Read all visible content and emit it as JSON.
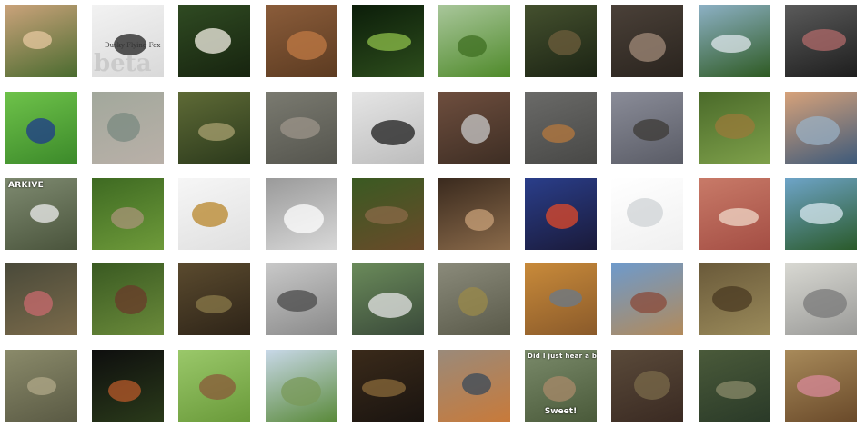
{
  "grid": {
    "rows": 5,
    "cols": 10,
    "tiles": [
      {
        "subject": "leopard-gecko",
        "bg": [
          "#c9a27a",
          "#4a6b2f"
        ],
        "accent": "#e7c8a0"
      },
      {
        "subject": "book-cover",
        "bg": [
          "#f2f2f2",
          "#d9d9d9"
        ],
        "accent": "#222222",
        "title": "Dusky Flying Fox",
        "big": "beta"
      },
      {
        "subject": "white-flower",
        "bg": [
          "#2f4a22",
          "#17240f"
        ],
        "accent": "#f4f0e6"
      },
      {
        "subject": "salamander-on-leaves",
        "bg": [
          "#8a5c3a",
          "#5c3b21"
        ],
        "accent": "#c07a44"
      },
      {
        "subject": "tree-frog",
        "bg": [
          "#0c1e0a",
          "#2d4d1c"
        ],
        "accent": "#8dbf4a"
      },
      {
        "subject": "meadow",
        "bg": [
          "#a8c69a",
          "#4f8a2a"
        ],
        "accent": "#3f6f22"
      },
      {
        "subject": "owl-in-tree",
        "bg": [
          "#44502e",
          "#1c2414"
        ],
        "accent": "#6e5e3c"
      },
      {
        "subject": "split-shell",
        "bg": [
          "#4a4038",
          "#2a241e"
        ],
        "accent": "#a08a78"
      },
      {
        "subject": "greenhouse-dome",
        "bg": [
          "#8cb0c4",
          "#2e5a22"
        ],
        "accent": "#dfe7ec"
      },
      {
        "subject": "dark-panel",
        "bg": [
          "#5a5a5a",
          "#1e1e1e"
        ],
        "accent": "#b06a6a"
      },
      {
        "subject": "blue-dart-frog",
        "bg": [
          "#6ec24a",
          "#3c8a2a"
        ],
        "accent": "#1e3a8c"
      },
      {
        "subject": "fabric-texture",
        "bg": [
          "#a2a89c",
          "#b9b0a8"
        ],
        "accent": "#7a8a80"
      },
      {
        "subject": "forest-stream",
        "bg": [
          "#5e6a36",
          "#2c3a1c"
        ],
        "accent": "#a8a070"
      },
      {
        "subject": "rock-surface",
        "bg": [
          "#7a7a70",
          "#55554e"
        ],
        "accent": "#9c948a"
      },
      {
        "subject": "bee-on-white",
        "bg": [
          "#e5e5e5",
          "#bdbdbd"
        ],
        "accent": "#1e1e1e"
      },
      {
        "subject": "gloved-hands-gravel",
        "bg": [
          "#6e4e3e",
          "#3e2e24"
        ],
        "accent": "#c8c8c8"
      },
      {
        "subject": "toad-on-rock",
        "bg": [
          "#6a6a68",
          "#484846"
        ],
        "accent": "#b5783e"
      },
      {
        "subject": "frog-in-burrow",
        "bg": [
          "#8a8c98",
          "#5a5c66"
        ],
        "accent": "#3c3a36"
      },
      {
        "subject": "newt-in-grass",
        "bg": [
          "#4a6a2a",
          "#7ea04a"
        ],
        "accent": "#9a7a3a"
      },
      {
        "subject": "lake-sunset",
        "bg": [
          "#d7a27a",
          "#3e5a7a"
        ],
        "accent": "#9ab0c4"
      },
      {
        "subject": "branches",
        "bg": [
          "#7e8a70",
          "#4a543c"
        ],
        "accent": "#eeeeee",
        "caption": "ARKIVE"
      },
      {
        "subject": "seed-pod",
        "bg": [
          "#3e6a22",
          "#6e9a3a"
        ],
        "accent": "#a89478"
      },
      {
        "subject": "golden-figurine",
        "bg": [
          "#f6f6f6",
          "#e0e0e0"
        ],
        "accent": "#b8862a"
      },
      {
        "subject": "sem-structure",
        "bg": [
          "#9a9a9a",
          "#d8d8d8"
        ],
        "accent": "#ffffff"
      },
      {
        "subject": "hedgehog-pair",
        "bg": [
          "#3a5a22",
          "#6a4a2a"
        ],
        "accent": "#8a6a48"
      },
      {
        "subject": "deer",
        "bg": [
          "#3a2a1e",
          "#8a6a4a"
        ],
        "accent": "#c8a078"
      },
      {
        "subject": "race-car",
        "bg": [
          "#2a3e8a",
          "#1a1a3a"
        ],
        "accent": "#e0492a"
      },
      {
        "subject": "white-suv",
        "bg": [
          "#ffffff",
          "#f0f0f0"
        ],
        "accent": "#cfd3d6"
      },
      {
        "subject": "braided-strands",
        "bg": [
          "#c87a68",
          "#a44e44"
        ],
        "accent": "#f0d8c8"
      },
      {
        "subject": "lily-pond",
        "bg": [
          "#6ea4c8",
          "#2a5a2a"
        ],
        "accent": "#d8e8f0"
      },
      {
        "subject": "fingertip-beetle",
        "bg": [
          "#4a4a3a",
          "#7a6a4a"
        ],
        "accent": "#c86a6e"
      },
      {
        "subject": "salamander-moss",
        "bg": [
          "#3a5a22",
          "#6a8a3a"
        ],
        "accent": "#6a3a2a"
      },
      {
        "subject": "frog-on-bark",
        "bg": [
          "#5a4a2e",
          "#2e2418"
        ],
        "accent": "#8a7a4a"
      },
      {
        "subject": "micrograph-panels",
        "bg": [
          "#c8c8c8",
          "#8a8a8a"
        ],
        "accent": "#4a4a4a"
      },
      {
        "subject": "river-vehicle",
        "bg": [
          "#6a8a5a",
          "#3a4a3a"
        ],
        "accent": "#e6e6e6"
      },
      {
        "subject": "frog-in-gravel",
        "bg": [
          "#8a8a7a",
          "#5a5a4a"
        ],
        "accent": "#9a8a4a"
      },
      {
        "subject": "fish-in-rocks",
        "bg": [
          "#c88a3a",
          "#8a5a2a"
        ],
        "accent": "#6a7a8a"
      },
      {
        "subject": "brick-house",
        "bg": [
          "#6e9acb",
          "#b28a5a"
        ],
        "accent": "#8a4a3a"
      },
      {
        "subject": "toad-closeup",
        "bg": [
          "#6a5a3a",
          "#9a8a5a"
        ],
        "accent": "#4a3a22"
      },
      {
        "subject": "seal-pups",
        "bg": [
          "#d8d8d2",
          "#9a9a98"
        ],
        "accent": "#7a7a7a"
      },
      {
        "subject": "leaf-litter",
        "bg": [
          "#8a8a6a",
          "#5a5a44"
        ],
        "accent": "#b0a888"
      },
      {
        "subject": "newt-on-black",
        "bg": [
          "#0e0e0e",
          "#2a3a1a"
        ],
        "accent": "#b85a2a"
      },
      {
        "subject": "frog-on-leaf",
        "bg": [
          "#9ac86a",
          "#6a9a3a"
        ],
        "accent": "#8a5a3a"
      },
      {
        "subject": "park-pond",
        "bg": [
          "#c8d8e8",
          "#5a8a3a"
        ],
        "accent": "#7a9a5a"
      },
      {
        "subject": "dark-frog",
        "bg": [
          "#3a2a1a",
          "#1a1410"
        ],
        "accent": "#8a6a3a"
      },
      {
        "subject": "tadpole-rock",
        "bg": [
          "#9a8a7a",
          "#c87a3a"
        ],
        "accent": "#3a4a5a"
      },
      {
        "subject": "kangaroo-meme",
        "bg": [
          "#7a8a6a",
          "#4a5a3a"
        ],
        "accent": "#a88a6a",
        "caption_top": "Did I just hear a big?",
        "caption_bottom": "Sweet!"
      },
      {
        "subject": "frog-in-stream",
        "bg": [
          "#5a4a3a",
          "#3a2a22"
        ],
        "accent": "#7a6a4a"
      },
      {
        "subject": "frog-on-mossy-rock",
        "bg": [
          "#4a5a3a",
          "#2a3a28"
        ],
        "accent": "#8a8a6a"
      },
      {
        "subject": "lizard-open-mouth",
        "bg": [
          "#a88a5a",
          "#6a4a2a"
        ],
        "accent": "#d88a9a"
      }
    ]
  }
}
